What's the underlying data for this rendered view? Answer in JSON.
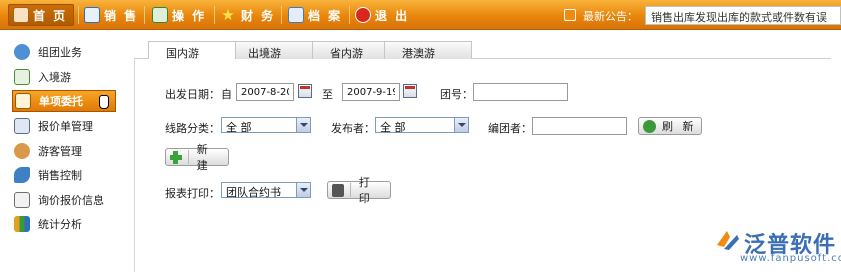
{
  "nav": {
    "items": [
      {
        "label": "首 页",
        "icon": "home-icon",
        "color": "#d66a12"
      },
      {
        "label": "销 售",
        "icon": "sales-icon",
        "color": "#2e6fbd"
      },
      {
        "label": "操 作",
        "icon": "operation-icon",
        "color": "#2f8a2f"
      },
      {
        "label": "财 务",
        "icon": "finance-star-icon",
        "color": "#f2c21a"
      },
      {
        "label": "档 案",
        "icon": "archive-icon",
        "color": "#3b7cc2"
      },
      {
        "label": "退 出",
        "icon": "exit-icon",
        "color": "#c8281e"
      }
    ],
    "announcement_label": "最新公告：",
    "announcement_text": "销售出库发现出库的款式或件数有误"
  },
  "sidebar": {
    "items": [
      {
        "label": "组团业务",
        "icon": "group-icon"
      },
      {
        "label": "入境游",
        "icon": "inbound-icon"
      },
      {
        "label": "单项委托",
        "icon": "entrust-icon"
      },
      {
        "label": "报价单管理",
        "icon": "quote-icon"
      },
      {
        "label": "游客管理",
        "icon": "tourist-icon"
      },
      {
        "label": "销售控制",
        "icon": "sales-control-icon"
      },
      {
        "label": "询价报价信息",
        "icon": "inquiry-icon"
      },
      {
        "label": "统计分析",
        "icon": "statistics-icon"
      }
    ],
    "active_index": 2
  },
  "tabs": [
    {
      "label": "国内游",
      "active": true
    },
    {
      "label": "出境游",
      "active": false
    },
    {
      "label": "省内游",
      "active": false
    },
    {
      "label": "港澳游",
      "active": false
    }
  ],
  "form": {
    "departure_label": "出发日期：",
    "from_label": "自",
    "start_date": "2007-8-20",
    "to_label": "至",
    "end_date": "2007-9-19",
    "group_no_label": "团号：",
    "group_no_value": "",
    "route_label": "线路分类：",
    "route_value": "全 部",
    "publisher_label": "发布者：",
    "publisher_value": "全 部",
    "editor_label": "编团者：",
    "editor_value": "",
    "refresh_label": "刷 新",
    "new_label": "新 建",
    "print_label_text": "报表打印：",
    "print_select_value": "团队合约书",
    "print_button": "打 印"
  },
  "brand": {
    "name": "泛普软件",
    "url": "www.fanpusoft.com"
  }
}
